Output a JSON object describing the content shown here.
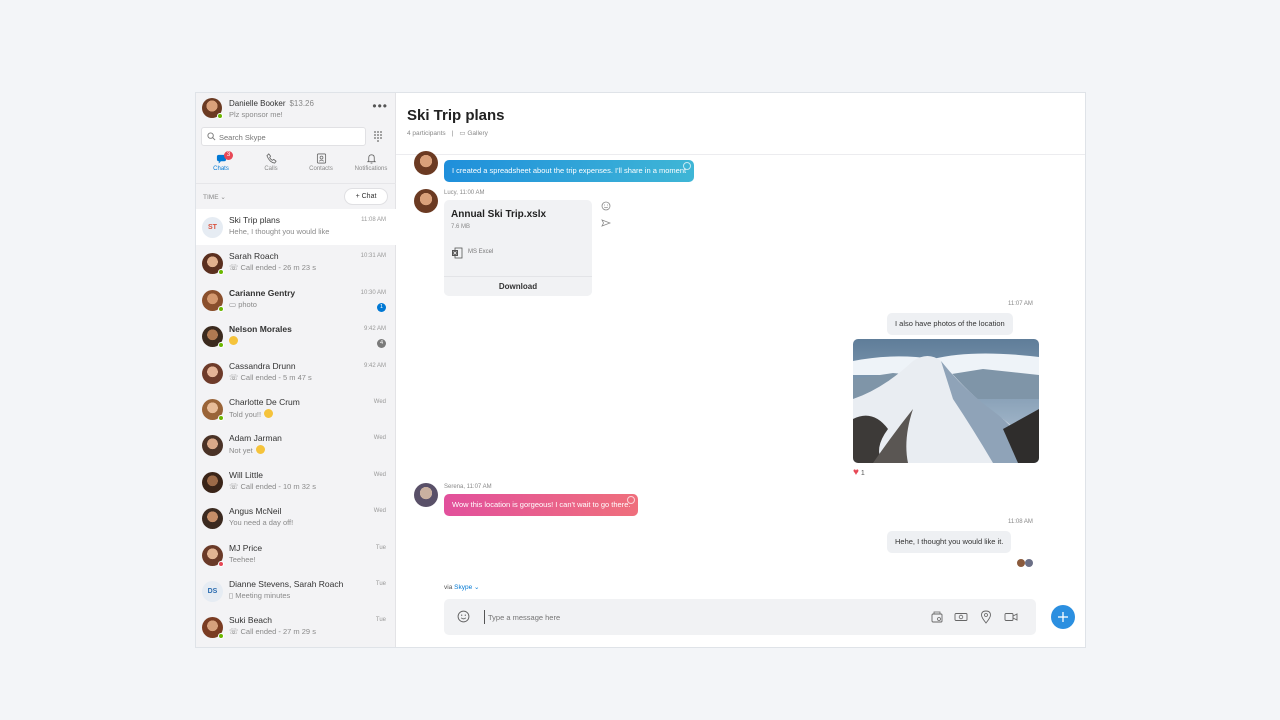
{
  "profile": {
    "name": "Danielle Booker",
    "balance": "$13.26",
    "mood": "Plz sponsor me!"
  },
  "search": {
    "placeholder": "Search Skype"
  },
  "nav": {
    "chats": "Chats",
    "chats_badge": "3",
    "calls": "Calls",
    "contacts": "Contacts",
    "notifications": "Notifications"
  },
  "sort": {
    "label": "TIME",
    "new_chat": "Chat"
  },
  "chats": [
    {
      "initials": "ST",
      "name": "Ski Trip plans",
      "preview": "Hehe, I thought you would like",
      "time": "11:08 AM"
    },
    {
      "name": "Sarah Roach",
      "preview": "Call ended - 26 m 23 s",
      "time": "10:31 AM"
    },
    {
      "name": "Carianne Gentry",
      "preview": "photo",
      "time": "10:30 AM",
      "badge": "1"
    },
    {
      "name": "Nelson Morales",
      "time": "9:42 AM",
      "badge": "4"
    },
    {
      "name": "Cassandra Drunn",
      "preview": "Call ended - 5 m 47 s",
      "time": "9:42 AM"
    },
    {
      "name": "Charlotte De Crum",
      "preview": "Told you!!",
      "time": "Wed"
    },
    {
      "name": "Adam Jarman",
      "preview": "Not yet",
      "time": "Wed"
    },
    {
      "name": "Will Little",
      "preview": "Call ended - 10 m 32 s",
      "time": "Wed"
    },
    {
      "name": "Angus McNeil",
      "preview": "You need a day off!",
      "time": "Wed"
    },
    {
      "name": "MJ Price",
      "preview": "Teehee!",
      "time": "Tue"
    },
    {
      "initials": "DS",
      "name": "Dianne Stevens, Sarah Roach",
      "preview": "Meeting minutes",
      "time": "Tue"
    },
    {
      "name": "Suki Beach",
      "preview": "Call ended - 27 m 29 s",
      "time": "Tue"
    }
  ],
  "conversation": {
    "title": "Ski Trip plans",
    "participants": "4 participants",
    "gallery": "Gallery",
    "messages": {
      "m1_text": "I created a spreadsheet about the trip expenses. I'll share in a moment",
      "m2_meta": "Lucy, 11:00 AM",
      "file_name": "Annual Ski Trip.xslx",
      "file_size": "7.6 MB",
      "file_type": "MS Excel",
      "file_action": "Download",
      "m3_time": "11:07 AM",
      "m3_text": "I also have photos of the location",
      "heart_count": "1",
      "m4_meta": "Serena, 11:07 AM",
      "m4_text": "Wow this location is gorgeous! I can't wait to go there.",
      "m5_time": "11:08 AM",
      "m5_text": "Hehe, I thought you would like it."
    },
    "via_prefix": "via",
    "via_app": "Skype",
    "composer_placeholder": "Type a message here"
  },
  "colors": {
    "accent": "#0078d4",
    "presence_online": "#6bb700",
    "badge_red": "#e74856"
  }
}
